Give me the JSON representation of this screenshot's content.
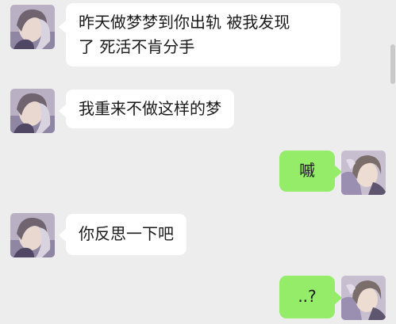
{
  "colors": {
    "background": "#ededed",
    "incoming_bubble": "#ffffff",
    "outgoing_bubble": "#95ec69",
    "text": "#1a1a1a"
  },
  "messages": [
    {
      "side": "incoming",
      "text": "昨天做梦梦到你出轨 被我发现\n了 死活不肯分手",
      "avatar": "contact-avatar"
    },
    {
      "side": "incoming",
      "text": "我重来不做这样的梦",
      "avatar": "contact-avatar"
    },
    {
      "side": "outgoing",
      "text": "嘁",
      "avatar": "self-avatar"
    },
    {
      "side": "incoming",
      "text": "你反思一下吧",
      "avatar": "contact-avatar"
    },
    {
      "side": "outgoing",
      "text": "..?",
      "avatar": "self-avatar"
    }
  ]
}
